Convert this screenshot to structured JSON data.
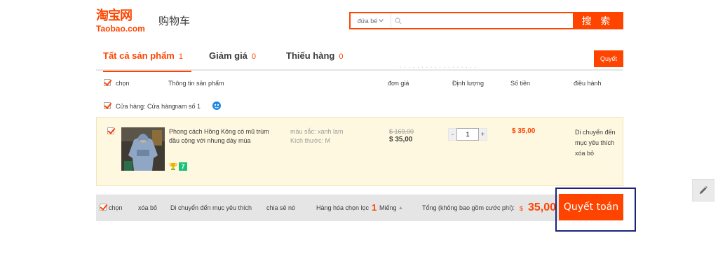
{
  "header": {
    "logo_cn": "淘宝网",
    "logo_en": "Taobao.com",
    "title": "购物车",
    "search": {
      "category": "đứa bé",
      "button": "搜 索",
      "value": ""
    }
  },
  "tabs": [
    {
      "label": "Tất cả sản phẩm",
      "count": "1"
    },
    {
      "label": "Giảm giá",
      "count": "0"
    },
    {
      "label": "Thiếu hàng",
      "count": "0"
    }
  ],
  "top_settle": "Quyết",
  "tab_note": "· · · · ·  ·  ·  · ·  · · · · ·  · ·  · ·",
  "table_header": {
    "select": "chọn",
    "info": "Thông tin sản phẩm",
    "price": "đơn giá",
    "qty": "Định lượng",
    "sum": "Số tiền",
    "op": "điều hành"
  },
  "store": {
    "label": "Cửa hàng: Cửa hàng",
    "name": "nam số 1"
  },
  "item": {
    "title": "Phong cách Hồng Kông có mũ trùm đầu cộng với nhung dày mùa",
    "color": "màu sắc: xanh lam",
    "size": "Kích thước: M",
    "old_price": "$ 169,00",
    "price": "$ 35,00",
    "qty": "1",
    "qty_minus": "-",
    "qty_plus": "+",
    "sum": "$ 35,00",
    "badge_b": "7",
    "op_fav": "Di chuyển đến mục yêu thích",
    "op_del": "xóa bỏ"
  },
  "footer": {
    "select": "chọn",
    "delete": "xóa bỏ",
    "favorite": "Di chuyển đến mục yêu thích",
    "share": "chia sẻ nó",
    "count_label": "Hàng hóa chọn lọc",
    "count": "1",
    "unit": "Miếng",
    "caret": "▲",
    "total_label": "Tổng (không bao gồm cước phí):",
    "currency": "$",
    "total": "35,00",
    "settle": "Quyết toán"
  },
  "colors": {
    "accent": "#ff4400",
    "item_bg": "#fff8e1",
    "footer_bg": "#e5e5e5",
    "frame": "#1a237e"
  }
}
